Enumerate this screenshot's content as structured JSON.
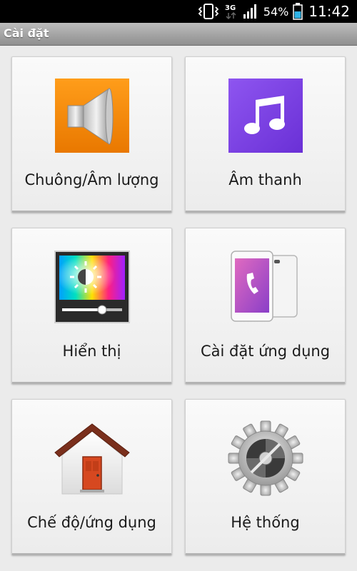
{
  "status_bar": {
    "network": "3G",
    "battery_percent": "54%",
    "time": "11:42",
    "icons": [
      "vibrate-icon",
      "network-3g-icon",
      "signal-icon",
      "battery-icon"
    ]
  },
  "title_bar": {
    "title": "Cài đặt"
  },
  "tiles": [
    {
      "label": "Chuông/Âm lượng",
      "icon": "speaker-icon",
      "color": "#f28c00"
    },
    {
      "label": "Âm thanh",
      "icon": "music-note-icon",
      "color": "#7b3fe0"
    },
    {
      "label": "Hiển thị",
      "icon": "display-brightness-icon"
    },
    {
      "label": "Cài đặt ứng dụng",
      "icon": "phone-apps-icon"
    },
    {
      "label": "Chế độ/ứng dụng",
      "icon": "home-icon"
    },
    {
      "label": "Hệ thống",
      "icon": "gear-icon"
    }
  ]
}
